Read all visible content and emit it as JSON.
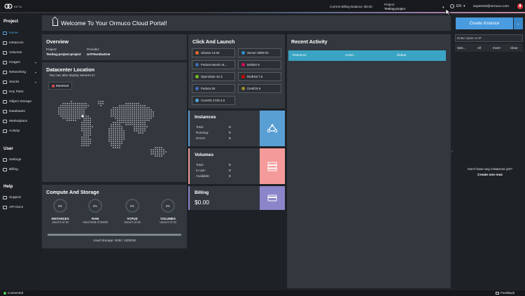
{
  "topbar": {
    "logo_badge": "BETA",
    "billing_balance": "Current Billing Balance: $0.00",
    "project_label": "Project",
    "project_value": "Testing-project",
    "language": "EN",
    "user_email": "supertest@ormuco.com"
  },
  "sidebar": {
    "project_heading": "Project",
    "project_items": [
      "Home",
      "Instances",
      "Volumes",
      "Images",
      "Networking",
      "Stacks",
      "Key Pairs",
      "Object Storage",
      "Databases",
      "Marketplace",
      "Activity"
    ],
    "user_heading": "User",
    "user_items": [
      "Settings",
      "Billing"
    ],
    "help_heading": "Help",
    "help_items": [
      "Support",
      "API Docs"
    ]
  },
  "welcome": {
    "title": "Welcome To Your Ormuco Cloud Portal!"
  },
  "overview": {
    "title": "Overview",
    "project_key": "Project:",
    "project_value": "Testing-project-project",
    "provider_key": "Provider:",
    "provider_value": "UATNumbaOne"
  },
  "datacenter": {
    "title": "Datacenter Location",
    "subtitle": "You can also deploy servers in:",
    "location": "Montreal"
  },
  "compute": {
    "title": "Compute And Storage",
    "gauges": [
      {
        "percent": "0%",
        "label": "INSTANCES",
        "sub": "Used 0 of 10"
      },
      {
        "percent": "0%",
        "label": "RAM",
        "sub": "Used 0GB of 50GB"
      },
      {
        "percent": "0%",
        "label": "VCPUS",
        "sub": "Used 0 of 25"
      },
      {
        "percent": "0%",
        "label": "VOLUMES",
        "sub": "Used 0 of 10"
      }
    ],
    "storage_fraction": 1.0,
    "storage_label": "Used Storage: 0GB / 1000GB"
  },
  "launch": {
    "title": "Click And Launch",
    "images": [
      {
        "name": "Ubuntu 14.04",
        "color": "#e2692c"
      },
      {
        "name": "Server 2008 R2",
        "color": "#2c8fd6"
      },
      {
        "name": "Fedora-atomic-st...",
        "color": "#3c6eb4"
      },
      {
        "name": "Debian 9",
        "color": "#d70a53"
      },
      {
        "name": "OpenSuse 42.3",
        "color": "#73ba25"
      },
      {
        "name": "RedHat 7.5",
        "color": "#cc0000"
      },
      {
        "name": "Fedora 28",
        "color": "#3c6eb4"
      },
      {
        "name": "CentOS 6",
        "color": "#9b8a2f"
      },
      {
        "name": "CoreOS 1745.4.0",
        "color": "#53a3da"
      }
    ]
  },
  "instances": {
    "title": "Instances",
    "rows": [
      {
        "k": "Total:",
        "v": "0"
      },
      {
        "k": "Running:",
        "v": "0"
      },
      {
        "k": "Errors:",
        "v": "0"
      }
    ],
    "color": "#5a9fd4"
  },
  "volumes": {
    "title": "Volumes",
    "rows": [
      {
        "k": "Total:",
        "v": "0"
      },
      {
        "k": "In use:",
        "v": "0"
      },
      {
        "k": "Available:",
        "v": "0"
      }
    ],
    "color": "#f49a9a"
  },
  "billing": {
    "title": "Billing",
    "amount": "$0.00",
    "color": "#8b86c9"
  },
  "activity": {
    "title": "Recent Activity",
    "columns": [
      "Resource",
      "Action",
      "Status"
    ]
  },
  "right": {
    "create_label": "Create Instance",
    "search_placeholder": "Enter name or IP",
    "selectors": [
      "Sele...",
      "All",
      "Invert",
      "Clear"
    ],
    "empty_text": "Don't have any instances yet?",
    "empty_link": "Create one now"
  },
  "footer": {
    "status": "Connected",
    "feedback": "Feedback"
  }
}
